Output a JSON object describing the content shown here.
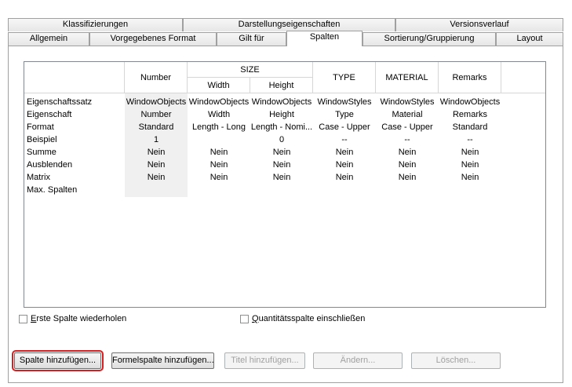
{
  "tabs_row1": [
    "Klassifizierungen",
    "Darstellungseigenschaften",
    "Versionsverlauf"
  ],
  "tabs_row2": [
    "Allgemein",
    "Vorgegebenes Format",
    "Gilt für",
    "Spalten",
    "Sortierung/Gruppierung",
    "Layout"
  ],
  "active_tab": "Spalten",
  "grid": {
    "headers": {
      "number": "Number",
      "size": "SIZE",
      "width": "Width",
      "height": "Height",
      "type": "TYPE",
      "material": "MATERIAL",
      "remarks": "Remarks"
    },
    "row_labels": [
      "Eigenschaftssatz",
      "Eigenschaft",
      "Format",
      "Beispiel",
      "Summe",
      "Ausblenden",
      "Matrix",
      "Max. Spalten"
    ],
    "columns": [
      [
        "WindowObjects",
        "Number",
        "Standard",
        "1",
        "Nein",
        "Nein",
        "Nein"
      ],
      [
        "WindowObjects",
        "Width",
        "Length - Long",
        "",
        "Nein",
        "Nein",
        "Nein"
      ],
      [
        "WindowObjects",
        "Height",
        "Length - Nomi...",
        "0",
        "Nein",
        "Nein",
        "Nein"
      ],
      [
        "WindowStyles",
        "Type",
        "Case - Upper",
        "--",
        "Nein",
        "Nein",
        "Nein"
      ],
      [
        "WindowStyles",
        "Material",
        "Case - Upper",
        "--",
        "Nein",
        "Nein",
        "Nein"
      ],
      [
        "WindowObjects",
        "Remarks",
        "Standard",
        "--",
        "Nein",
        "Nein",
        "Nein"
      ]
    ]
  },
  "checkboxes": {
    "repeat_first": "Erste Spalte wiederholen",
    "quantity": "Quantitätsspalte einschließen"
  },
  "buttons": {
    "add_column": "Spalte hinzufügen...",
    "add_formula": "Formelspalte hinzufügen...",
    "add_title": "Titel hinzufügen...",
    "modify": "Ändern...",
    "delete": "Löschen..."
  }
}
